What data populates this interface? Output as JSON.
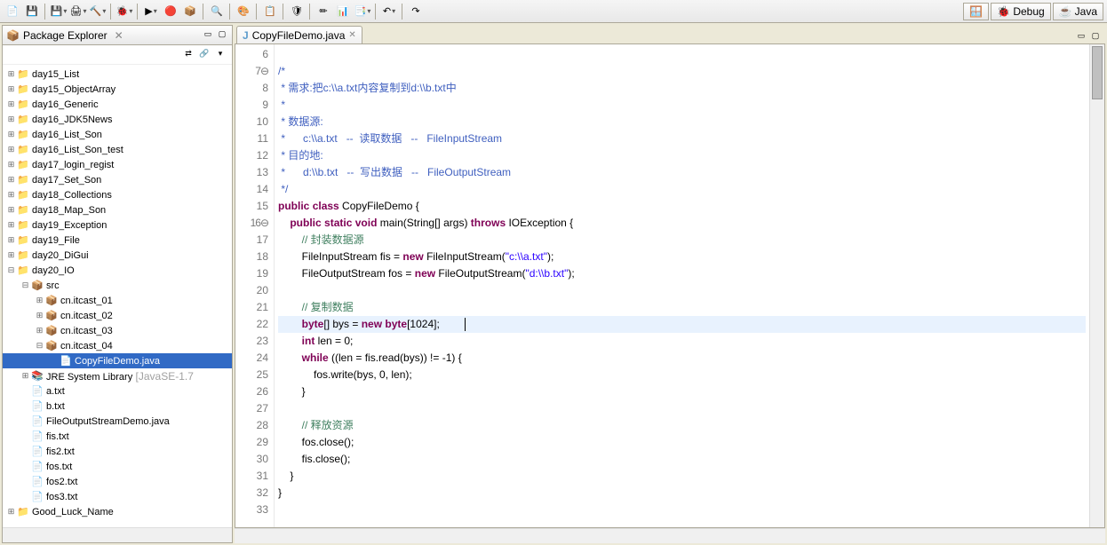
{
  "toolbar": {
    "buttons": [
      "📄",
      "💾",
      "💾",
      "🖨",
      "🔨",
      "🐞",
      "▶",
      "🔴",
      "📦",
      "🔍",
      "🎨",
      "📋",
      "🛡",
      "✏",
      "📊",
      "📑",
      "↶",
      "↷"
    ],
    "perspectives": [
      {
        "icon": "🪟",
        "label": ""
      },
      {
        "icon": "🐞",
        "label": "Debug"
      },
      {
        "icon": "☕",
        "label": "Java"
      }
    ]
  },
  "explorer": {
    "title": "Package Explorer",
    "close": "✕",
    "toolbar_icons": [
      "⇄",
      "🔗",
      "▾"
    ],
    "tree": [
      {
        "l": 0,
        "tw": "⊞",
        "i": "folder",
        "t": "day15_List"
      },
      {
        "l": 0,
        "tw": "⊞",
        "i": "folder",
        "t": "day15_ObjectArray"
      },
      {
        "l": 0,
        "tw": "⊞",
        "i": "folder",
        "t": "day16_Generic"
      },
      {
        "l": 0,
        "tw": "⊞",
        "i": "folder",
        "t": "day16_JDK5News"
      },
      {
        "l": 0,
        "tw": "⊞",
        "i": "folder",
        "t": "day16_List_Son"
      },
      {
        "l": 0,
        "tw": "⊞",
        "i": "folder",
        "t": "day16_List_Son_test"
      },
      {
        "l": 0,
        "tw": "⊞",
        "i": "folder",
        "t": "day17_login_regist"
      },
      {
        "l": 0,
        "tw": "⊞",
        "i": "folder",
        "t": "day17_Set_Son"
      },
      {
        "l": 0,
        "tw": "⊞",
        "i": "folder",
        "t": "day18_Collections"
      },
      {
        "l": 0,
        "tw": "⊞",
        "i": "folder",
        "t": "day18_Map_Son"
      },
      {
        "l": 0,
        "tw": "⊞",
        "i": "folder",
        "t": "day19_Exception"
      },
      {
        "l": 0,
        "tw": "⊞",
        "i": "folder",
        "t": "day19_File"
      },
      {
        "l": 0,
        "tw": "⊞",
        "i": "folder",
        "t": "day20_DiGui"
      },
      {
        "l": 0,
        "tw": "⊟",
        "i": "folder",
        "t": "day20_IO"
      },
      {
        "l": 1,
        "tw": "⊟",
        "i": "pkg",
        "t": "src"
      },
      {
        "l": 2,
        "tw": "⊞",
        "i": "pkg",
        "t": "cn.itcast_01"
      },
      {
        "l": 2,
        "tw": "⊞",
        "i": "pkg",
        "t": "cn.itcast_02"
      },
      {
        "l": 2,
        "tw": "⊞",
        "i": "pkg",
        "t": "cn.itcast_03"
      },
      {
        "l": 2,
        "tw": "⊟",
        "i": "pkg",
        "t": "cn.itcast_04"
      },
      {
        "l": 3,
        "tw": "",
        "i": "java",
        "t": "CopyFileDemo.java",
        "sel": true
      },
      {
        "l": 1,
        "tw": "⊞",
        "i": "lib",
        "t": "JRE System Library",
        "decor": " [JavaSE-1.7"
      },
      {
        "l": 1,
        "tw": "",
        "i": "file",
        "t": "a.txt"
      },
      {
        "l": 1,
        "tw": "",
        "i": "file",
        "t": "b.txt"
      },
      {
        "l": 1,
        "tw": "",
        "i": "java",
        "t": "FileOutputStreamDemo.java"
      },
      {
        "l": 1,
        "tw": "",
        "i": "file",
        "t": "fis.txt"
      },
      {
        "l": 1,
        "tw": "",
        "i": "file",
        "t": "fis2.txt"
      },
      {
        "l": 1,
        "tw": "",
        "i": "file",
        "t": "fos.txt"
      },
      {
        "l": 1,
        "tw": "",
        "i": "file",
        "t": "fos2.txt"
      },
      {
        "l": 1,
        "tw": "",
        "i": "file",
        "t": "fos3.txt"
      },
      {
        "l": 0,
        "tw": "⊞",
        "i": "folder",
        "t": "Good_Luck_Name"
      }
    ]
  },
  "editor": {
    "tab": {
      "icon": "J",
      "name": "CopyFileDemo.java",
      "close": "✕"
    },
    "lines": [
      {
        "n": 6,
        "h": ""
      },
      {
        "n": 7,
        "h": "/*",
        "c": "cmd",
        "mark": "⊖"
      },
      {
        "n": 8,
        "h": " * 需求:把c:\\\\a.txt内容复制到d:\\\\b.txt中",
        "c": "cmd"
      },
      {
        "n": 9,
        "h": " * ",
        "c": "cmd"
      },
      {
        "n": 10,
        "h": " * 数据源:",
        "c": "cmd"
      },
      {
        "n": 11,
        "h": " *      c:\\\\a.txt   --  读取数据   --   FileInputStream",
        "c": "cmd"
      },
      {
        "n": 12,
        "h": " * 目的地:",
        "c": "cmd"
      },
      {
        "n": 13,
        "h": " *      d:\\\\b.txt   --  写出数据   --   FileOutputStream",
        "c": "cmd"
      },
      {
        "n": 14,
        "h": " */",
        "c": "cmd"
      },
      {
        "n": 15,
        "raw": "<span class='kw'>public</span> <span class='kw'>class</span> CopyFileDemo {"
      },
      {
        "n": 16,
        "raw": "    <span class='kw'>public</span> <span class='kw'>static</span> <span class='kw'>void</span> main(String[] args) <span class='kw'>throws</span> IOException {",
        "mark": "⊖"
      },
      {
        "n": 17,
        "raw": "        <span class='cm'>// 封装数据源</span>"
      },
      {
        "n": 18,
        "raw": "        FileInputStream fis = <span class='kw'>new</span> FileInputStream(<span class='str'>\"c:\\\\a.txt\"</span>);"
      },
      {
        "n": 19,
        "raw": "        FileOutputStream fos = <span class='kw'>new</span> FileOutputStream(<span class='str'>\"d:\\\\b.txt\"</span>);"
      },
      {
        "n": 20,
        "h": ""
      },
      {
        "n": 21,
        "raw": "        <span class='cm'>// 复制数据</span>"
      },
      {
        "n": 22,
        "raw": "        <span class='kw'>byte</span>[] bys = <span class='kw'>new</span> <span class='kw'>byte</span>[1024];",
        "hl": true,
        "cur": true
      },
      {
        "n": 23,
        "raw": "        <span class='kw'>int</span> len = 0;"
      },
      {
        "n": 24,
        "raw": "        <span class='kw'>while</span> ((len = fis.read(bys)) != -1) {"
      },
      {
        "n": 25,
        "raw": "            fos.write(bys, 0, len);"
      },
      {
        "n": 26,
        "h": "        }"
      },
      {
        "n": 27,
        "h": ""
      },
      {
        "n": 28,
        "raw": "        <span class='cm'>// 释放资源</span>"
      },
      {
        "n": 29,
        "h": "        fos.close();"
      },
      {
        "n": 30,
        "h": "        fis.close();"
      },
      {
        "n": 31,
        "h": "    }"
      },
      {
        "n": 32,
        "h": "}"
      },
      {
        "n": 33,
        "h": ""
      }
    ]
  }
}
